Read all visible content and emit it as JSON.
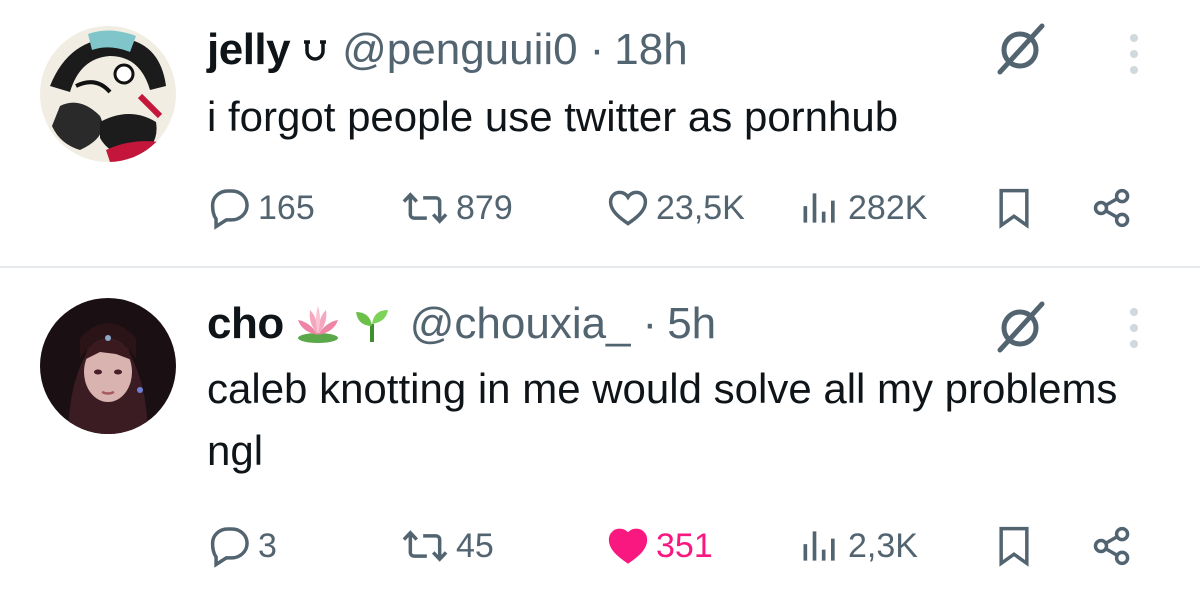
{
  "colors": {
    "text_primary": "#0f1419",
    "text_secondary": "#536471",
    "like_active": "#f91880",
    "divider": "#e6e9eb"
  },
  "tweets": [
    {
      "display_name": "jelly",
      "handle": "@penguuii0",
      "separator": "·",
      "time": "18h",
      "badge_icon": "horseshoe-badge-icon",
      "text": "i forgot people use twitter as pornhub",
      "replies": "165",
      "reposts": "879",
      "likes": "23,5K",
      "liked": false,
      "views": "282K"
    },
    {
      "display_name": "cho",
      "handle": "@chouxia_",
      "separator": "·",
      "time": "5h",
      "emoji_icons": [
        "lotus-icon",
        "seedling-icon"
      ],
      "text": "caleb knotting in me would solve all my problems ngl",
      "replies": "3",
      "reposts": "45",
      "likes": "351",
      "liked": true,
      "views": "2,3K"
    }
  ]
}
